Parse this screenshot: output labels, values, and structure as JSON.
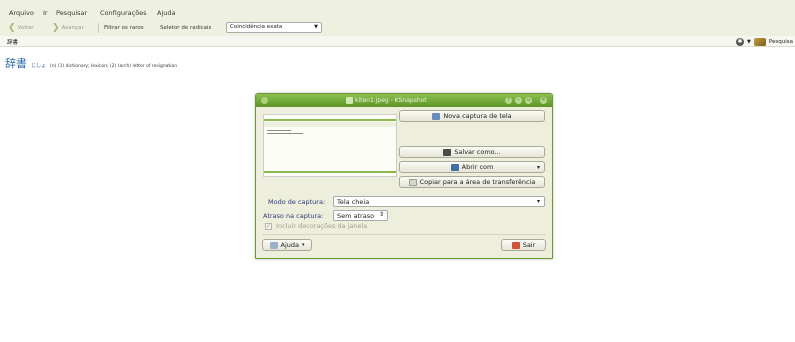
{
  "menu": [
    {
      "label": "Arquivo"
    },
    {
      "label": "Ir"
    },
    {
      "label": "Pesquisar"
    },
    {
      "label": "Configurações"
    },
    {
      "label": "Ajuda"
    }
  ],
  "toolbar": {
    "back_label": "Voltar",
    "forward_label": "Avançar",
    "filter_label": "Filtrar os raros",
    "radical_label": "Seletor de radicais",
    "match_value": "Coincidência exata"
  },
  "search": {
    "query": "辞書",
    "search_label": "Pesquisa"
  },
  "result": {
    "word": "辞書",
    "reading": "じしょ",
    "gloss": "(n) (1) dictionary; lexicon; (2) (arch) letter of resignation"
  },
  "dialog": {
    "title": "kiten1.jpeg - KSnapshot",
    "new_capture": "Nova captura de tela",
    "save_as": "Salvar como...",
    "open_with": "Abrir com",
    "copy_clipboard": "Copiar para a área de transferência",
    "mode_label": "Modo de captura:",
    "mode_value": "Tela cheia",
    "delay_label": "Atraso na captura:",
    "delay_value": "Sem atraso",
    "include_decorations": "Incluir decorações da janela",
    "help": "Ajuda",
    "quit": "Sair"
  },
  "colors": {
    "accent": "#6a9a30",
    "result_word": "#2a6aa8",
    "menubar_bg": "#eef0e0"
  }
}
